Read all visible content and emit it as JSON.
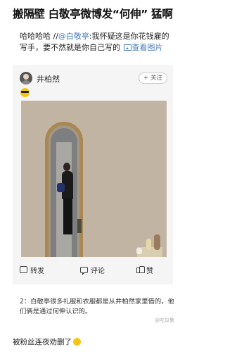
{
  "headline": "搬隔壁 白敬亭微博发“何伸” 猛啊",
  "post": {
    "prefix": "哈哈哈哈 //",
    "mention": "@白敬亭",
    "text": ":我怀疑这是你花钱雇的写手，要不然就是你自己写的",
    "image_link": "查看图片"
  },
  "card": {
    "author": "井柏然",
    "follow_label": "+ 关注",
    "actions": {
      "repost": "转发",
      "comment": "评论",
      "like": "赞"
    }
  },
  "comment_text": "2：白敬亭很多礼服和衣服都是从井柏然家里借的，他们俩是通过何伸认识的。",
  "watermark": "@吃瓜鲁",
  "caption": "被粉丝连夜劝删了"
}
